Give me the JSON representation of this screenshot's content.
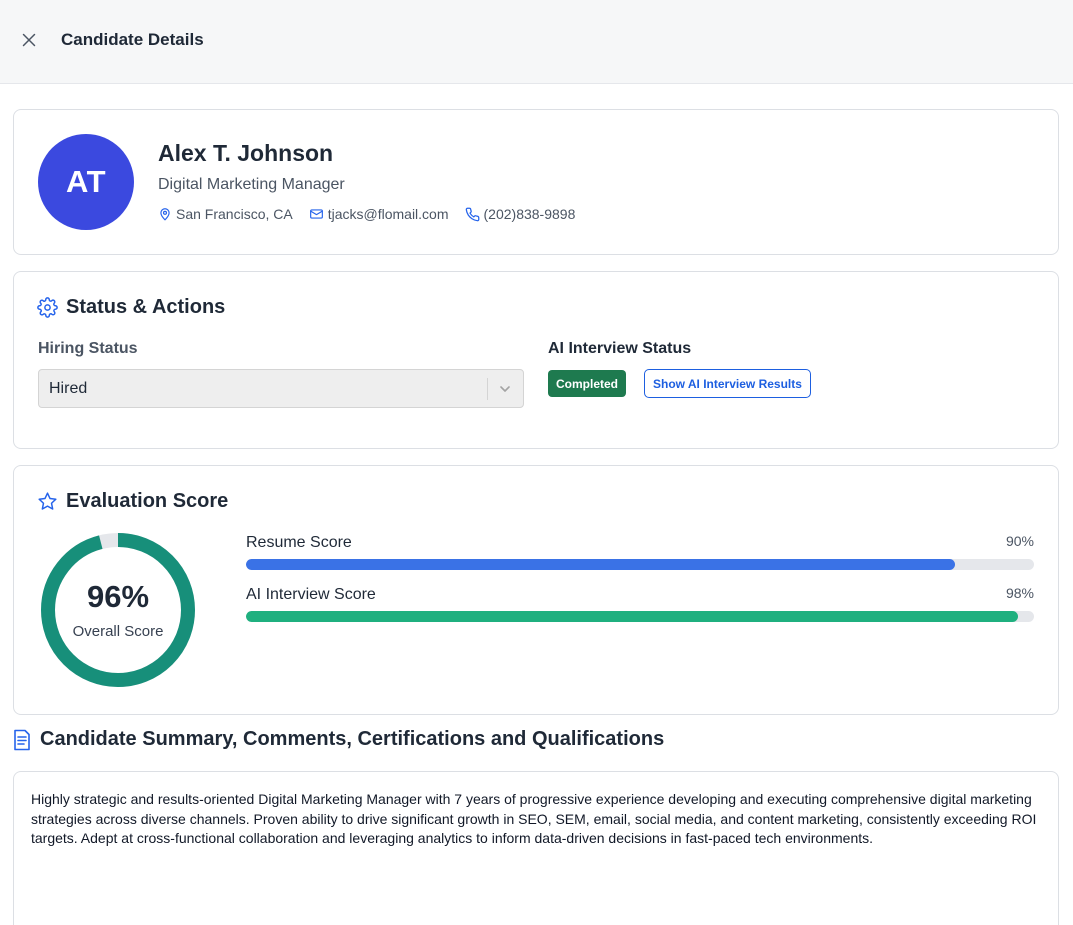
{
  "header": {
    "title": "Candidate Details"
  },
  "candidate": {
    "initials": "AT",
    "name": "Alex T. Johnson",
    "role": "Digital Marketing Manager",
    "location": "San Francisco, CA",
    "email": "tjacks@flomail.com",
    "phone": "(202)838-9898"
  },
  "status": {
    "title": "Status & Actions",
    "hiring_label": "Hiring Status",
    "hiring_value": "Hired",
    "ai_label": "AI Interview Status",
    "ai_badge": "Completed",
    "ai_button": "Show AI Interview Results"
  },
  "evaluation": {
    "title": "Evaluation Score",
    "overall_value": "96%",
    "overall_fraction": 0.96,
    "overall_label": "Overall Score",
    "scores": [
      {
        "label": "Resume Score",
        "value": "90%",
        "fraction": 0.9,
        "color": "#3a72e6"
      },
      {
        "label": "AI Interview Score",
        "value": "98%",
        "fraction": 0.98,
        "color": "#1fb07f"
      }
    ]
  },
  "summary": {
    "title": "Candidate Summary, Comments, Certifications and Qualifications",
    "text": "Highly strategic and results-oriented Digital Marketing Manager with 7 years of progressive experience developing and executing comprehensive digital marketing strategies across diverse channels. Proven ability to drive significant growth in SEO, SEM, email, social media, and content marketing, consistently exceeding ROI targets. Adept at cross-functional collaboration and leveraging analytics to inform data-driven decisions in fast-paced tech environments."
  },
  "colors": {
    "accent": "#1d5fe0",
    "avatar": "#3b49df",
    "donut": "#178f7a",
    "badge": "#1e7a4f"
  },
  "icons": [
    "close-icon",
    "map-pin-icon",
    "mail-icon",
    "phone-icon",
    "gear-icon",
    "star-icon",
    "chevron-down-icon",
    "document-icon"
  ]
}
